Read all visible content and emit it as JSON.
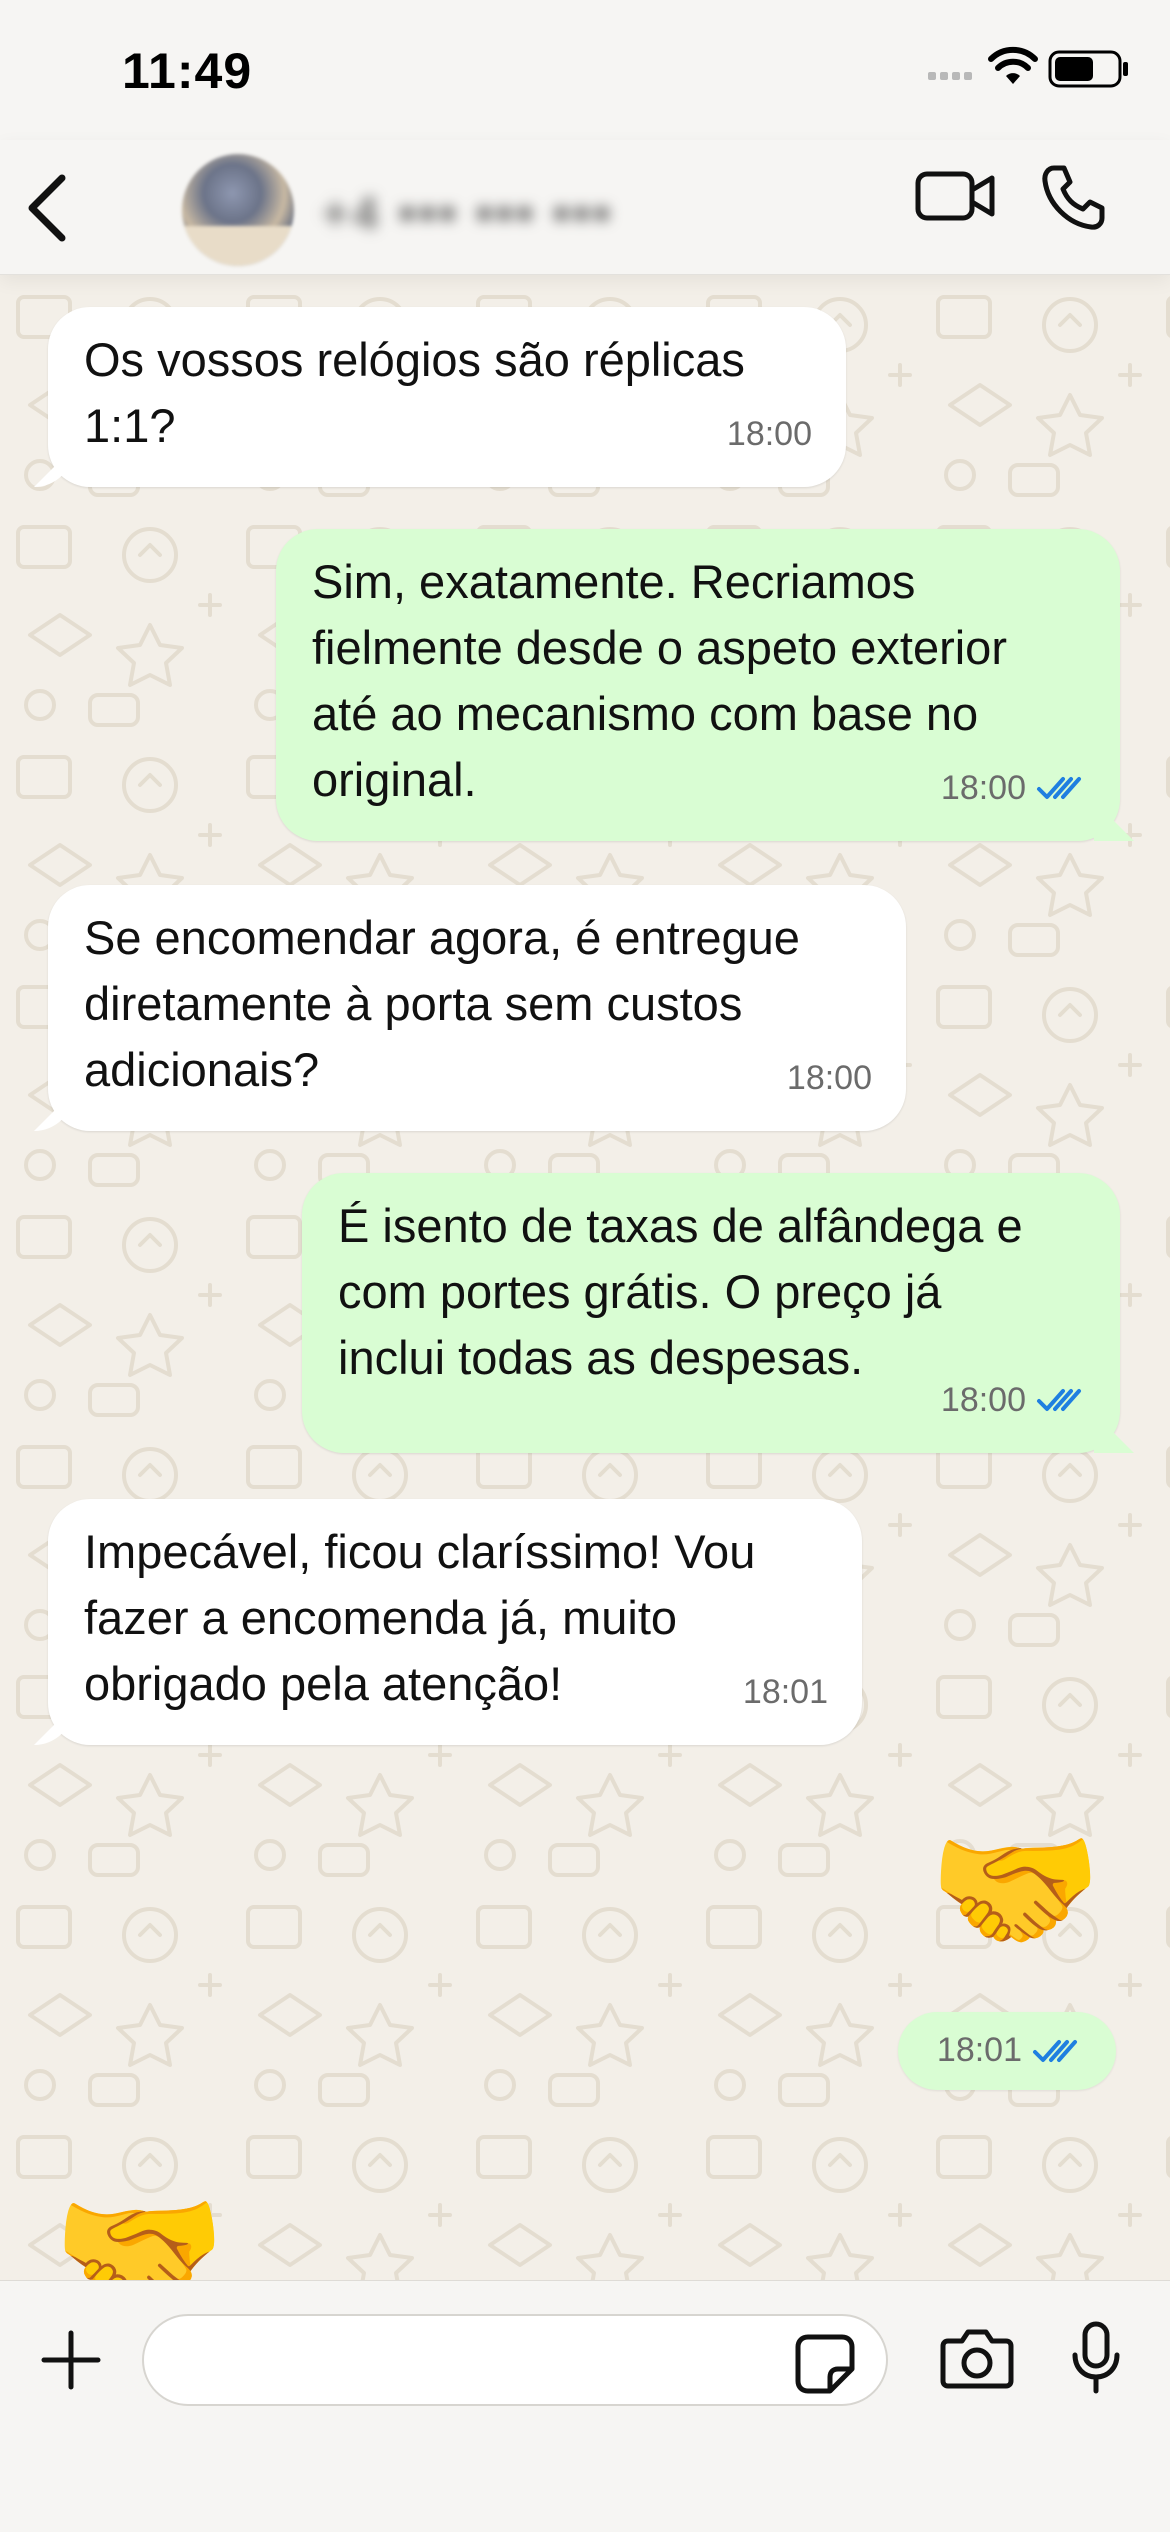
{
  "status_bar": {
    "time": "11:49"
  },
  "header": {
    "contact_name": "+4 ••• ••• •••",
    "icons": {
      "back": "chevron-left-icon",
      "video": "video-camera-icon",
      "call": "phone-icon"
    }
  },
  "messages": [
    {
      "direction": "in",
      "text": "Os vossos relógios são réplicas\n1:1?",
      "time": "18:00"
    },
    {
      "direction": "out",
      "text": "Sim, exatamente. Recriamos\nfielmente desde o aspeto exterior\naté ao mecanismo com base no\noriginal.",
      "time": "18:00",
      "status": "read"
    },
    {
      "direction": "in",
      "text": "Se encomendar agora, é entregue\ndiretamente à porta sem custos\nadicionais?",
      "time": "18:00"
    },
    {
      "direction": "out",
      "text": "É isento de taxas de alfândega e\ncom portes grátis. O preço já\ninclui todas as despesas.",
      "time": "18:00",
      "status": "read"
    },
    {
      "direction": "in",
      "text": "Impecável, ficou claríssimo! Vou\nfazer a encomenda já, muito\nobrigado pela atenção!",
      "time": "18:01"
    },
    {
      "direction": "out",
      "emoji": "🤝",
      "time": "18:01",
      "status": "read"
    },
    {
      "direction": "in",
      "emoji": "🤝"
    }
  ],
  "input_bar": {
    "placeholder": "",
    "icons": {
      "plus": "plus-icon",
      "sticker": "sticker-icon",
      "camera": "camera-icon",
      "mic": "microphone-icon"
    }
  },
  "colors": {
    "incoming_bubble": "#ffffff",
    "outgoing_bubble": "#d9fdd3",
    "read_ticks": "#1f7fe0",
    "chat_background": "#f3efe8"
  }
}
